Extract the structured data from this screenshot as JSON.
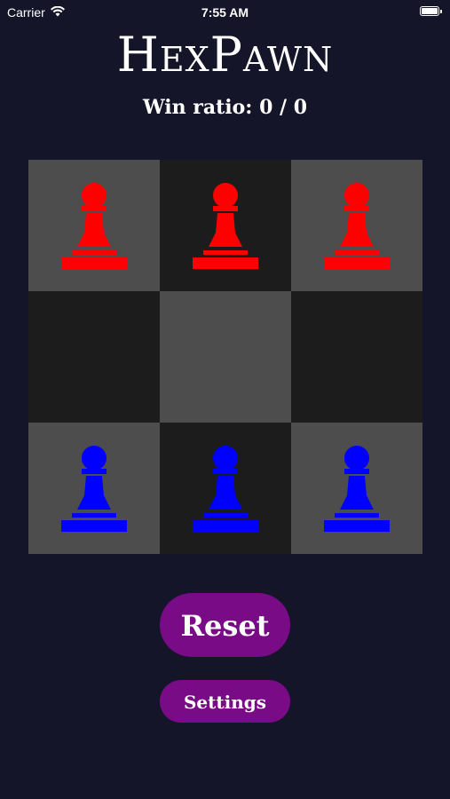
{
  "status_bar": {
    "carrier": "Carrier",
    "time": "7:55 AM",
    "battery_level": 1.0
  },
  "title": "HexPawn",
  "win_ratio_text": "Win ratio: 0 / 0",
  "colors": {
    "background": "#15152a",
    "light_square": "#4d4d4d",
    "dark_square": "#1c1c1c",
    "enemy_pawn": "#ff0000",
    "player_pawn": "#0000ff",
    "button": "#7a0b86"
  },
  "board": {
    "rows": [
      [
        {
          "shade": "light",
          "piece": "red"
        },
        {
          "shade": "dark",
          "piece": "red"
        },
        {
          "shade": "light",
          "piece": "red"
        }
      ],
      [
        {
          "shade": "dark",
          "piece": null
        },
        {
          "shade": "light",
          "piece": null
        },
        {
          "shade": "dark",
          "piece": null
        }
      ],
      [
        {
          "shade": "light",
          "piece": "blue"
        },
        {
          "shade": "dark",
          "piece": "blue"
        },
        {
          "shade": "light",
          "piece": "blue"
        }
      ]
    ]
  },
  "buttons": {
    "reset_label": "Reset",
    "settings_label": "Settings"
  }
}
